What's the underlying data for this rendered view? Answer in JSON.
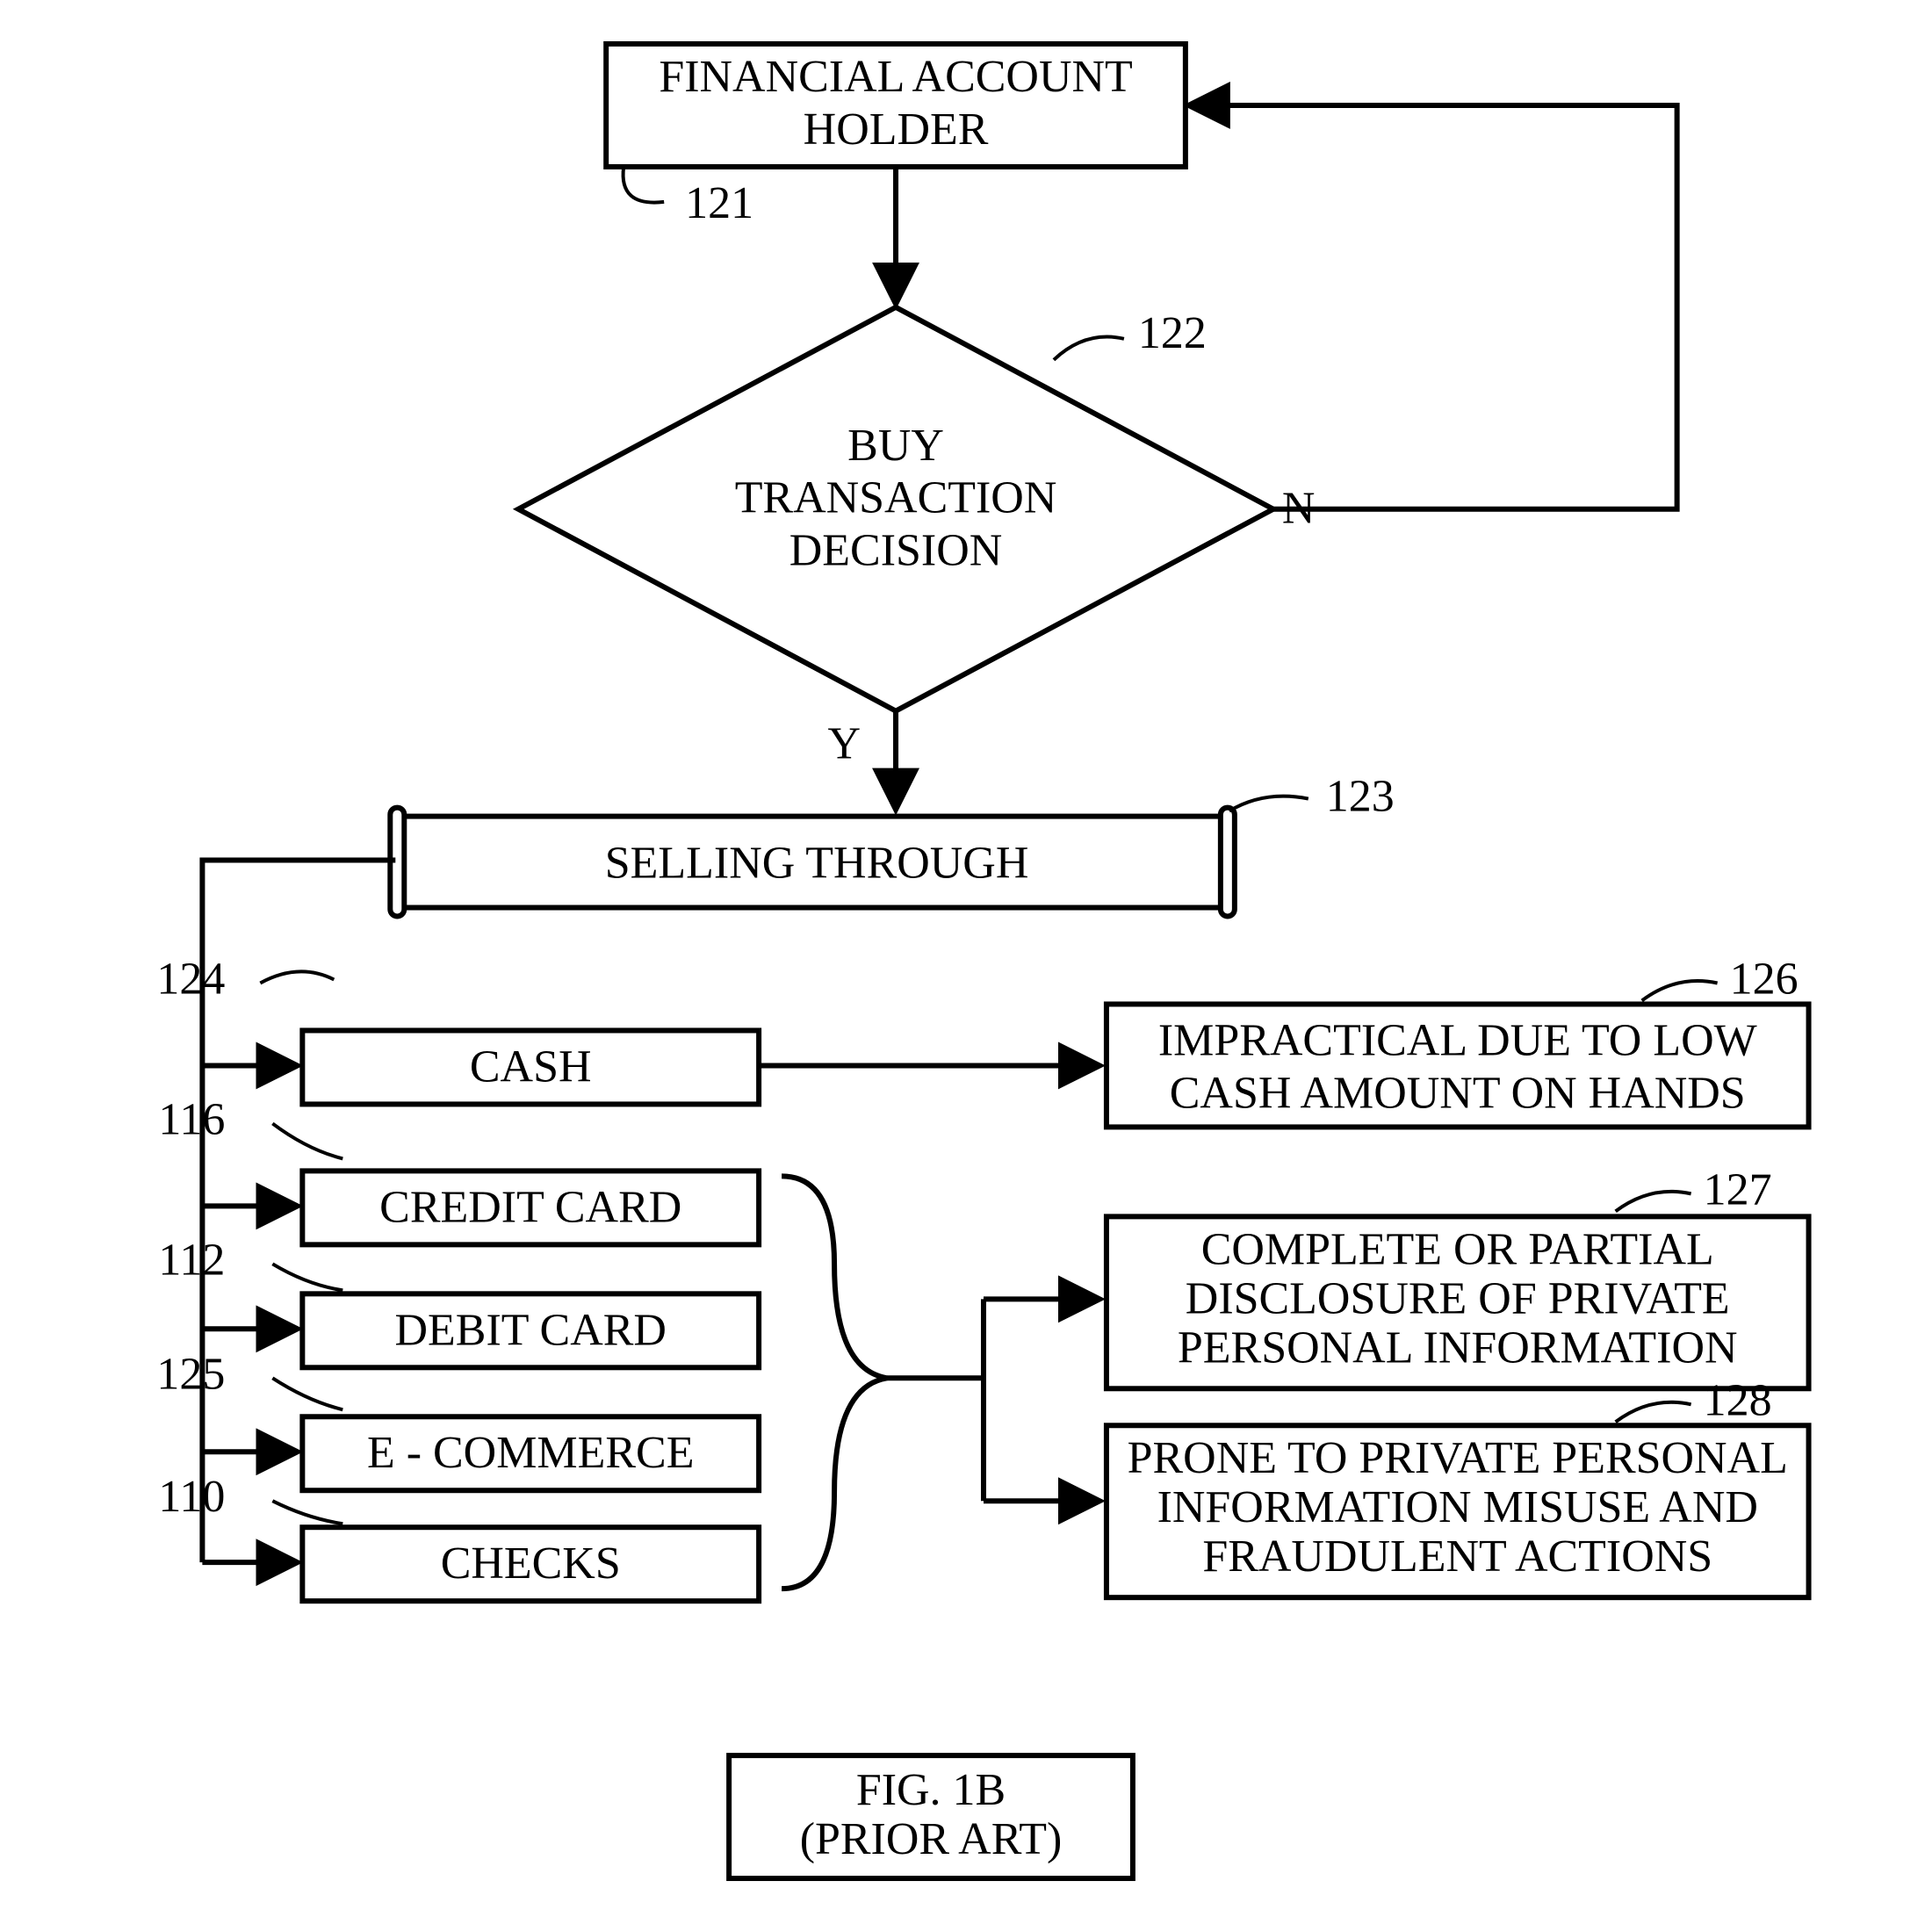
{
  "nodes": {
    "n121": {
      "lines": [
        "FINANCIAL ACCOUNT",
        "HOLDER"
      ],
      "ref": "121"
    },
    "n122": {
      "lines": [
        "BUY",
        "TRANSACTION",
        "DECISION"
      ],
      "ref": "122",
      "yes": "Y",
      "no": "N"
    },
    "n123": {
      "lines": [
        "SELLING THROUGH"
      ],
      "ref": "123"
    },
    "n124": {
      "lines": [
        "CASH"
      ],
      "ref": "124"
    },
    "n116": {
      "lines": [
        "CREDIT CARD"
      ],
      "ref": "116"
    },
    "n112": {
      "lines": [
        "DEBIT CARD"
      ],
      "ref": "112"
    },
    "n125": {
      "lines": [
        "E - COMMERCE"
      ],
      "ref": "125"
    },
    "n110": {
      "lines": [
        "CHECKS"
      ],
      "ref": "110"
    },
    "n126": {
      "lines": [
        "IMPRACTICAL DUE TO LOW",
        "CASH AMOUNT ON HANDS"
      ],
      "ref": "126"
    },
    "n127": {
      "lines": [
        "COMPLETE OR PARTIAL",
        "DISCLOSURE OF PRIVATE",
        "PERSONAL INFORMATION"
      ],
      "ref": "127"
    },
    "n128": {
      "lines": [
        "PRONE TO PRIVATE PERSONAL",
        "INFORMATION MISUSE AND",
        "FRAUDULENT ACTIONS"
      ],
      "ref": "128"
    }
  },
  "caption": {
    "lines": [
      "FIG. 1B",
      "(PRIOR ART)"
    ]
  }
}
